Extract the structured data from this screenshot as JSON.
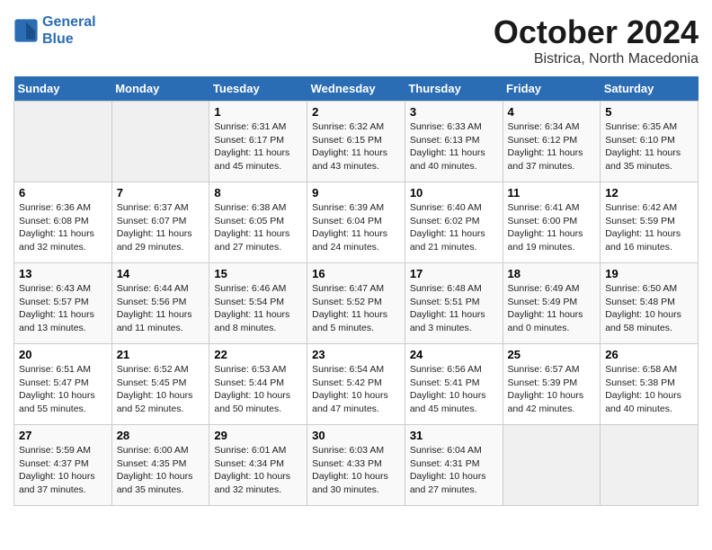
{
  "logo": {
    "line1": "General",
    "line2": "Blue"
  },
  "title": "October 2024",
  "subtitle": "Bistrica, North Macedonia",
  "weekdays": [
    "Sunday",
    "Monday",
    "Tuesday",
    "Wednesday",
    "Thursday",
    "Friday",
    "Saturday"
  ],
  "weeks": [
    [
      {
        "day": "",
        "info": ""
      },
      {
        "day": "",
        "info": ""
      },
      {
        "day": "1",
        "info": "Sunrise: 6:31 AM\nSunset: 6:17 PM\nDaylight: 11 hours and 45 minutes."
      },
      {
        "day": "2",
        "info": "Sunrise: 6:32 AM\nSunset: 6:15 PM\nDaylight: 11 hours and 43 minutes."
      },
      {
        "day": "3",
        "info": "Sunrise: 6:33 AM\nSunset: 6:13 PM\nDaylight: 11 hours and 40 minutes."
      },
      {
        "day": "4",
        "info": "Sunrise: 6:34 AM\nSunset: 6:12 PM\nDaylight: 11 hours and 37 minutes."
      },
      {
        "day": "5",
        "info": "Sunrise: 6:35 AM\nSunset: 6:10 PM\nDaylight: 11 hours and 35 minutes."
      }
    ],
    [
      {
        "day": "6",
        "info": "Sunrise: 6:36 AM\nSunset: 6:08 PM\nDaylight: 11 hours and 32 minutes."
      },
      {
        "day": "7",
        "info": "Sunrise: 6:37 AM\nSunset: 6:07 PM\nDaylight: 11 hours and 29 minutes."
      },
      {
        "day": "8",
        "info": "Sunrise: 6:38 AM\nSunset: 6:05 PM\nDaylight: 11 hours and 27 minutes."
      },
      {
        "day": "9",
        "info": "Sunrise: 6:39 AM\nSunset: 6:04 PM\nDaylight: 11 hours and 24 minutes."
      },
      {
        "day": "10",
        "info": "Sunrise: 6:40 AM\nSunset: 6:02 PM\nDaylight: 11 hours and 21 minutes."
      },
      {
        "day": "11",
        "info": "Sunrise: 6:41 AM\nSunset: 6:00 PM\nDaylight: 11 hours and 19 minutes."
      },
      {
        "day": "12",
        "info": "Sunrise: 6:42 AM\nSunset: 5:59 PM\nDaylight: 11 hours and 16 minutes."
      }
    ],
    [
      {
        "day": "13",
        "info": "Sunrise: 6:43 AM\nSunset: 5:57 PM\nDaylight: 11 hours and 13 minutes."
      },
      {
        "day": "14",
        "info": "Sunrise: 6:44 AM\nSunset: 5:56 PM\nDaylight: 11 hours and 11 minutes."
      },
      {
        "day": "15",
        "info": "Sunrise: 6:46 AM\nSunset: 5:54 PM\nDaylight: 11 hours and 8 minutes."
      },
      {
        "day": "16",
        "info": "Sunrise: 6:47 AM\nSunset: 5:52 PM\nDaylight: 11 hours and 5 minutes."
      },
      {
        "day": "17",
        "info": "Sunrise: 6:48 AM\nSunset: 5:51 PM\nDaylight: 11 hours and 3 minutes."
      },
      {
        "day": "18",
        "info": "Sunrise: 6:49 AM\nSunset: 5:49 PM\nDaylight: 11 hours and 0 minutes."
      },
      {
        "day": "19",
        "info": "Sunrise: 6:50 AM\nSunset: 5:48 PM\nDaylight: 10 hours and 58 minutes."
      }
    ],
    [
      {
        "day": "20",
        "info": "Sunrise: 6:51 AM\nSunset: 5:47 PM\nDaylight: 10 hours and 55 minutes."
      },
      {
        "day": "21",
        "info": "Sunrise: 6:52 AM\nSunset: 5:45 PM\nDaylight: 10 hours and 52 minutes."
      },
      {
        "day": "22",
        "info": "Sunrise: 6:53 AM\nSunset: 5:44 PM\nDaylight: 10 hours and 50 minutes."
      },
      {
        "day": "23",
        "info": "Sunrise: 6:54 AM\nSunset: 5:42 PM\nDaylight: 10 hours and 47 minutes."
      },
      {
        "day": "24",
        "info": "Sunrise: 6:56 AM\nSunset: 5:41 PM\nDaylight: 10 hours and 45 minutes."
      },
      {
        "day": "25",
        "info": "Sunrise: 6:57 AM\nSunset: 5:39 PM\nDaylight: 10 hours and 42 minutes."
      },
      {
        "day": "26",
        "info": "Sunrise: 6:58 AM\nSunset: 5:38 PM\nDaylight: 10 hours and 40 minutes."
      }
    ],
    [
      {
        "day": "27",
        "info": "Sunrise: 5:59 AM\nSunset: 4:37 PM\nDaylight: 10 hours and 37 minutes."
      },
      {
        "day": "28",
        "info": "Sunrise: 6:00 AM\nSunset: 4:35 PM\nDaylight: 10 hours and 35 minutes."
      },
      {
        "day": "29",
        "info": "Sunrise: 6:01 AM\nSunset: 4:34 PM\nDaylight: 10 hours and 32 minutes."
      },
      {
        "day": "30",
        "info": "Sunrise: 6:03 AM\nSunset: 4:33 PM\nDaylight: 10 hours and 30 minutes."
      },
      {
        "day": "31",
        "info": "Sunrise: 6:04 AM\nSunset: 4:31 PM\nDaylight: 10 hours and 27 minutes."
      },
      {
        "day": "",
        "info": ""
      },
      {
        "day": "",
        "info": ""
      }
    ]
  ]
}
